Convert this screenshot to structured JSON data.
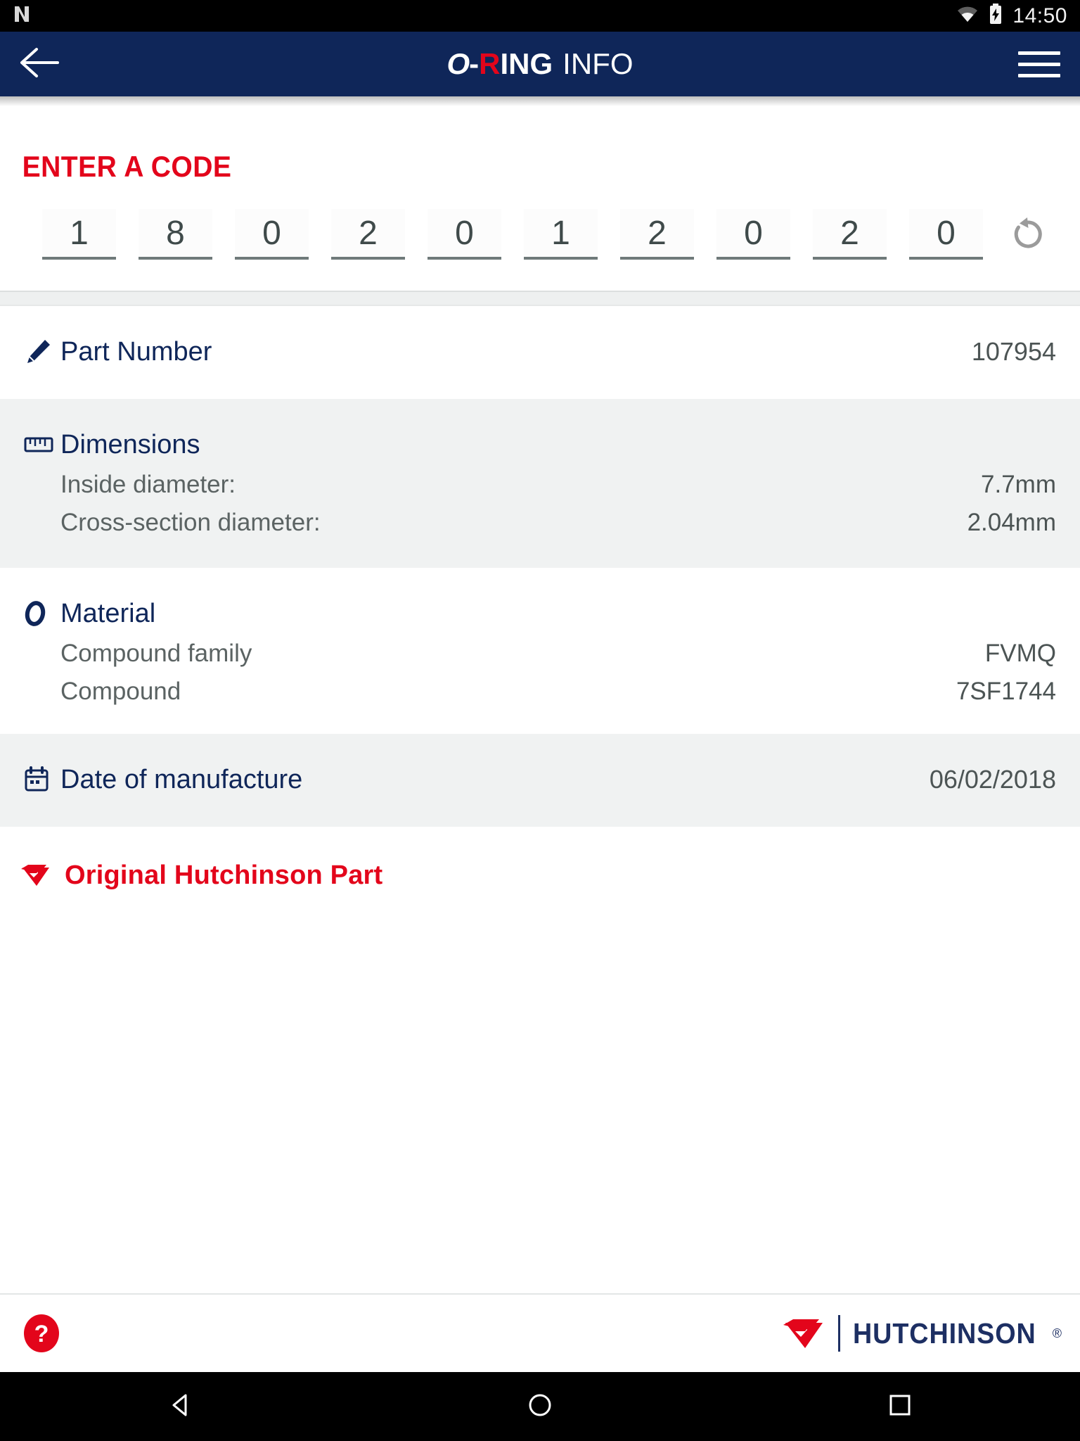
{
  "status_bar": {
    "time": "14:50",
    "icons": [
      "notification-icon",
      "wifi-icon",
      "battery-charging-icon"
    ]
  },
  "header": {
    "back_icon": "back-arrow-icon",
    "menu_icon": "hamburger-menu-icon",
    "logo": {
      "o": "O",
      "dash": "-",
      "r": "R",
      "ing": "ING",
      "info": "INFO"
    },
    "background_color": "#0f2659",
    "accent_color": "#e3051b"
  },
  "code_section": {
    "title": "ENTER A CODE",
    "digits": [
      "1",
      "8",
      "0",
      "2",
      "0",
      "1",
      "2",
      "0",
      "2",
      "0"
    ],
    "reset_icon": "reset-arrow-icon",
    "title_color": "#e3051b"
  },
  "rows": {
    "part_number": {
      "icon": "pencil-edit-icon",
      "label": "Part Number",
      "value": "107954"
    },
    "dimensions": {
      "icon": "ruler-icon",
      "label": "Dimensions",
      "items": [
        {
          "label": "Inside diameter:",
          "value": "7.7mm"
        },
        {
          "label": "Cross-section diameter:",
          "value": "2.04mm"
        }
      ]
    },
    "material": {
      "icon": "o-ring-icon",
      "label": "Material",
      "items": [
        {
          "label": "Compound family",
          "value": "FVMQ"
        },
        {
          "label": "Compound",
          "value": "7SF1744"
        }
      ]
    },
    "date_of_manufacture": {
      "icon": "calendar-icon",
      "label": "Date of manufacture",
      "value": "06/02/2018"
    }
  },
  "original_part": {
    "icon": "hutchinson-mark-icon",
    "label": "Original Hutchinson Part",
    "color": "#e3051b"
  },
  "footer": {
    "help_icon": "help-question-icon",
    "brand_mark_icon": "hutchinson-mark-icon",
    "brand_name": "HUTCHINSON",
    "brand_registered": "®",
    "brand_color": "#1d2f63"
  },
  "nav_bar": {
    "back_icon": "android-back-icon",
    "home_icon": "android-home-icon",
    "recents_icon": "android-recents-icon"
  }
}
